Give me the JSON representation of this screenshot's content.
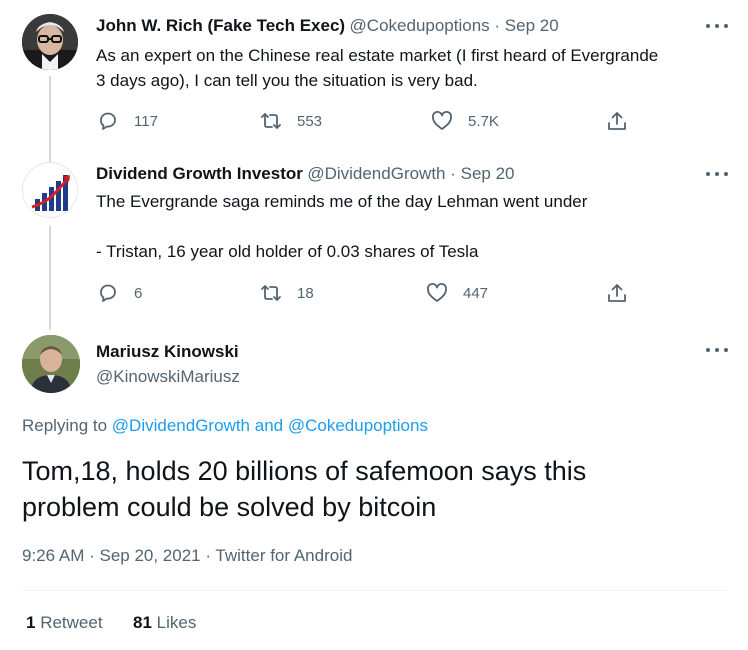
{
  "tweets": [
    {
      "author_name": "John W. Rich (Fake Tech Exec)",
      "handle_date": "@Cokedupoptions · Sep 20",
      "text_lines": [
        "As an expert on the Chinese real estate market (I first heard of Evergrande",
        "3 days ago), I can tell you the situation is very bad."
      ],
      "replies": "117",
      "retweets": "553",
      "likes": "5.7K"
    },
    {
      "author_name": "Dividend Growth Investor",
      "handle_date": "@DividendGrowth · Sep 20",
      "text_lines": [
        "The Evergrande saga reminds me of the day Lehman went under",
        "",
        "- Tristan, 16 year old holder of 0.03 shares of Tesla"
      ],
      "replies": "6",
      "retweets": "18",
      "likes": "447"
    }
  ],
  "main_tweet": {
    "author_name": "Mariusz Kinowski",
    "handle": "@KinowskiMariusz",
    "replying_prefix": "Replying to",
    "replying_to_1": "@DividendGrowth",
    "replying_and": "and",
    "replying_to_2": "@Cokedupoptions",
    "text_lines": [
      "Tom,18, holds 20 billions of safemoon says this",
      "problem could be solved by bitcoin"
    ],
    "timestamp": "9:26 AM · Sep 20, 2021 · Twitter for Android",
    "retweet_count": "1",
    "retweet_label": "Retweet",
    "like_count": "81",
    "like_label": "Likes"
  },
  "colors": {
    "accent": "#1d9bf0",
    "muted": "#536471",
    "text": "#0f1419",
    "thread_line": "#cfd9de"
  },
  "icons": [
    "reply-icon",
    "retweet-icon",
    "like-icon",
    "share-icon",
    "more-icon"
  ]
}
